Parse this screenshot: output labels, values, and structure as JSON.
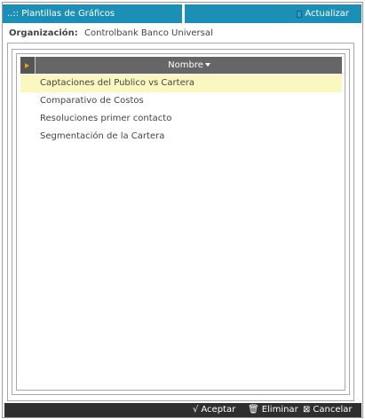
{
  "header": {
    "title": "..:: Plantillas de Gráficos",
    "refresh_label": "Actualizar"
  },
  "organization": {
    "label": "Organización:",
    "value": "Controlbank Banco Universal"
  },
  "grid": {
    "column_header": "Nombre",
    "rows": [
      "Captaciones del Publico vs Cartera",
      "Comparativo de Costos",
      "Resoluciones primer contacto",
      "Segmentación de la Cartera"
    ],
    "selected_index": 0
  },
  "footer": {
    "accept_icon": "√",
    "accept_label": "Aceptar",
    "delete_icon": "🗑",
    "delete_label": "Eliminar",
    "cancel_icon": "⊠",
    "cancel_label": "Cancelar"
  },
  "colors": {
    "header_bg": "#1b8fb6",
    "grid_header_bg": "#666666",
    "selected_row_bg": "#fbf7c0",
    "footer_bg": "#2f2f2f"
  }
}
